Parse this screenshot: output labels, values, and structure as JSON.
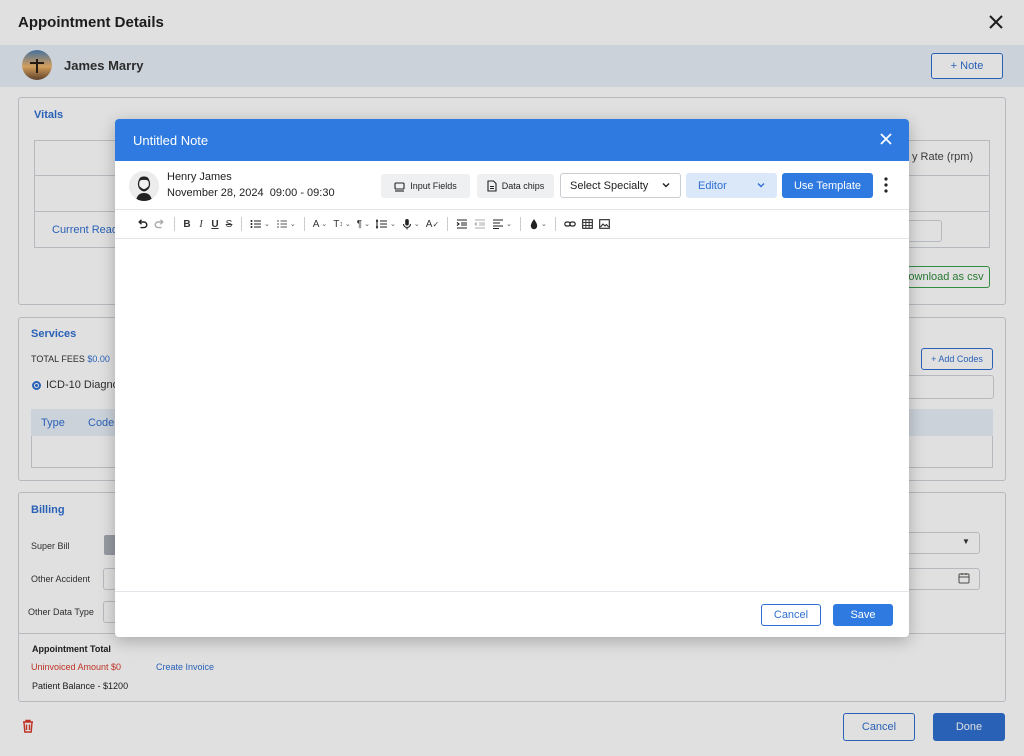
{
  "page": {
    "title": "Appointment Details",
    "patient_name": "James Marry",
    "note_button": "+ Note"
  },
  "vitals": {
    "title": "Vitals",
    "rate_header": "y Rate (rpm)",
    "current_reading": "Current Read",
    "download_csv": "ownload as csv"
  },
  "services": {
    "title": "Services",
    "total_fees_label": "TOTAL FEES",
    "total_fees_value": "$0.00",
    "add_codes": "+ Add Codes",
    "icd_label": "ICD-10 Diagno",
    "columns": [
      "Type",
      "Code"
    ]
  },
  "billing": {
    "title": "Billing",
    "super_bill": "Super Bill",
    "other_accident": "Other Accident",
    "other_data_type": "Other Data Type",
    "appointment_total": "Appointment Total",
    "uninvoiced": "Uninvoiced Amount $0",
    "create_invoice": "Create Invoice",
    "patient_balance": "Patient Balance - $1200"
  },
  "footer": {
    "cancel": "Cancel",
    "done": "Done"
  },
  "modal": {
    "title": "Untitled Note",
    "provider_name": "Henry James",
    "date": "November 28, 2024",
    "time": "09:00 - 09:30",
    "input_fields": "Input Fields",
    "data_chips": "Data chips",
    "specialty": "Select Specialty",
    "editor_mode": "Editor",
    "use_template": "Use Template",
    "cancel": "Cancel",
    "save": "Save"
  },
  "colors": {
    "primary": "#2f7ae0",
    "link": "#2f6fd1",
    "danger": "#d93a2b",
    "success": "#3aa04a"
  }
}
